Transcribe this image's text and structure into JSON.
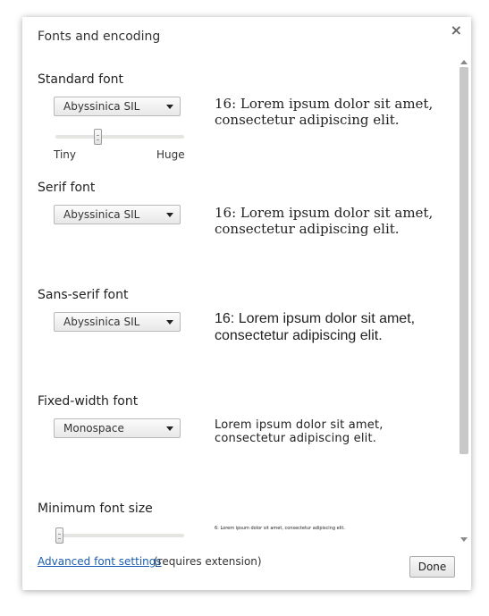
{
  "dialog": {
    "title": "Fonts and encoding"
  },
  "sections": {
    "standard": {
      "label": "Standard font",
      "selected": "Abyssinica SIL",
      "sample": "16: Lorem ipsum dolor sit amet, consectetur adipiscing elit.",
      "slider_min_label": "Tiny",
      "slider_max_label": "Huge",
      "size_level": 0.32
    },
    "serif": {
      "label": "Serif font",
      "selected": "Abyssinica SIL",
      "sample": "16: Lorem ipsum dolor sit amet, consectetur adipiscing elit."
    },
    "sans_serif": {
      "label": "Sans-serif font",
      "selected": "Abyssinica SIL",
      "sample": "16: Lorem ipsum dolor sit amet, consectetur adipiscing elit."
    },
    "fixed_width": {
      "label": "Fixed-width font",
      "selected": "Monospace",
      "sample": "Lorem ipsum dolor sit amet, consectetur adipiscing elit."
    },
    "minimum": {
      "label": "Minimum font size",
      "sample": "6: Lorem ipsum dolor sit amet, consectetur adipiscing elit.",
      "size_level": 0.0
    }
  },
  "footer": {
    "link": "Advanced font settings",
    "note": "(requires extension)",
    "done_label": "Done"
  },
  "icons": {
    "close": "close-icon",
    "dropdown": "chevron-down-icon"
  },
  "colors": {
    "link": "#1a5cb0",
    "scroll_thumb": "#c8c8c8"
  }
}
